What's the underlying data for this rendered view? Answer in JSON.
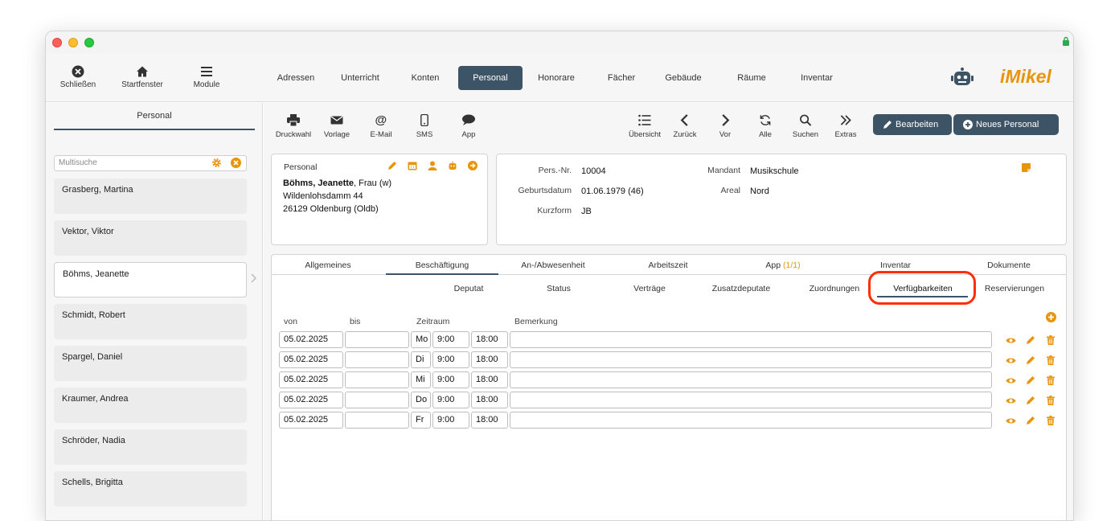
{
  "toolbar_left": [
    {
      "label": "Schließen",
      "icon": "close-circle-icon"
    },
    {
      "label": "Startfenster",
      "icon": "home-icon"
    },
    {
      "label": "Module",
      "icon": "menu-icon"
    }
  ],
  "nav_tabs": [
    "Adressen",
    "Unterricht",
    "Konten",
    "Personal",
    "Honorare",
    "Fächer",
    "Gebäude",
    "Räume",
    "Inventar"
  ],
  "active_nav": "Personal",
  "logo_text": "iMikel",
  "sidebar": {
    "title": "Personal",
    "search_placeholder": "Multisuche",
    "people": [
      "Grasberg, Martina",
      "Vektor, Viktor",
      "Böhms, Jeanette",
      "Schmidt, Robert",
      "Spargel, Daniel",
      "Kraumer, Andrea",
      "Schröder, Nadia",
      "Schells, Brigitta"
    ],
    "selected": "Böhms, Jeanette"
  },
  "tools_left": [
    {
      "label": "Druckwahl",
      "icon": "printer-icon"
    },
    {
      "label": "Vorlage",
      "icon": "envelope-icon"
    },
    {
      "label": "E-Mail",
      "icon": "at-icon"
    },
    {
      "label": "SMS",
      "icon": "phone-icon"
    },
    {
      "label": "App",
      "icon": "speech-bubble-icon"
    }
  ],
  "tools_right": [
    {
      "label": "Übersicht",
      "icon": "list-icon"
    },
    {
      "label": "Zurück",
      "icon": "chevron-left-icon"
    },
    {
      "label": "Vor",
      "icon": "chevron-right-icon"
    },
    {
      "label": "Alle",
      "icon": "refresh-icon"
    },
    {
      "label": "Suchen",
      "icon": "search-icon"
    },
    {
      "label": "Extras",
      "icon": "double-chevron-icon"
    }
  ],
  "buttons": {
    "edit": "Bearbeiten",
    "new": "Neues Personal"
  },
  "person_card": {
    "title": "Personal",
    "name_bold": "Böhms, Jeanette",
    "name_rest": ", Frau (w)",
    "street": "Wildenlohsdamm 44",
    "city": "26129 Oldenburg (Oldb)"
  },
  "info_card": {
    "pers_nr_label": "Pers.-Nr.",
    "pers_nr": "10004",
    "birth_label": "Geburtsdatum",
    "birth": "01.06.1979 (46)",
    "short_label": "Kurzform",
    "short": "JB",
    "client_label": "Mandant",
    "client": "Musikschule",
    "area_label": "Areal",
    "area": "Nord"
  },
  "main_tabs": [
    "Allgemeines",
    "Beschäftigung",
    "An-/Abwesenheit",
    "Arbeitszeit",
    "App",
    "Inventar",
    "Dokumente"
  ],
  "app_count": "(1/1)",
  "active_main_tab": "Beschäftigung",
  "sub_tabs": [
    "Deputat",
    "Status",
    "Verträge",
    "Zusatzdeputate",
    "Zuordnungen",
    "Verfügbarkeiten",
    "Reservierungen"
  ],
  "active_sub_tab": "Verfügbarkeiten",
  "table": {
    "headers": {
      "from": "von",
      "to": "bis",
      "period": "Zeitraum",
      "note": "Bemerkung"
    },
    "rows": [
      {
        "from": "05.02.2025",
        "to": "",
        "day": "Mo",
        "start": "9:00",
        "end": "18:00",
        "note": ""
      },
      {
        "from": "05.02.2025",
        "to": "",
        "day": "Di",
        "start": "9:00",
        "end": "18:00",
        "note": ""
      },
      {
        "from": "05.02.2025",
        "to": "",
        "day": "Mi",
        "start": "9:00",
        "end": "18:00",
        "note": ""
      },
      {
        "from": "05.02.2025",
        "to": "",
        "day": "Do",
        "start": "9:00",
        "end": "18:00",
        "note": ""
      },
      {
        "from": "05.02.2025",
        "to": "",
        "day": "Fr",
        "start": "9:00",
        "end": "18:00",
        "note": ""
      }
    ]
  },
  "colors": {
    "accent": "#e8940c",
    "dark": "#3d5466",
    "highlight": "#ff2d08"
  }
}
